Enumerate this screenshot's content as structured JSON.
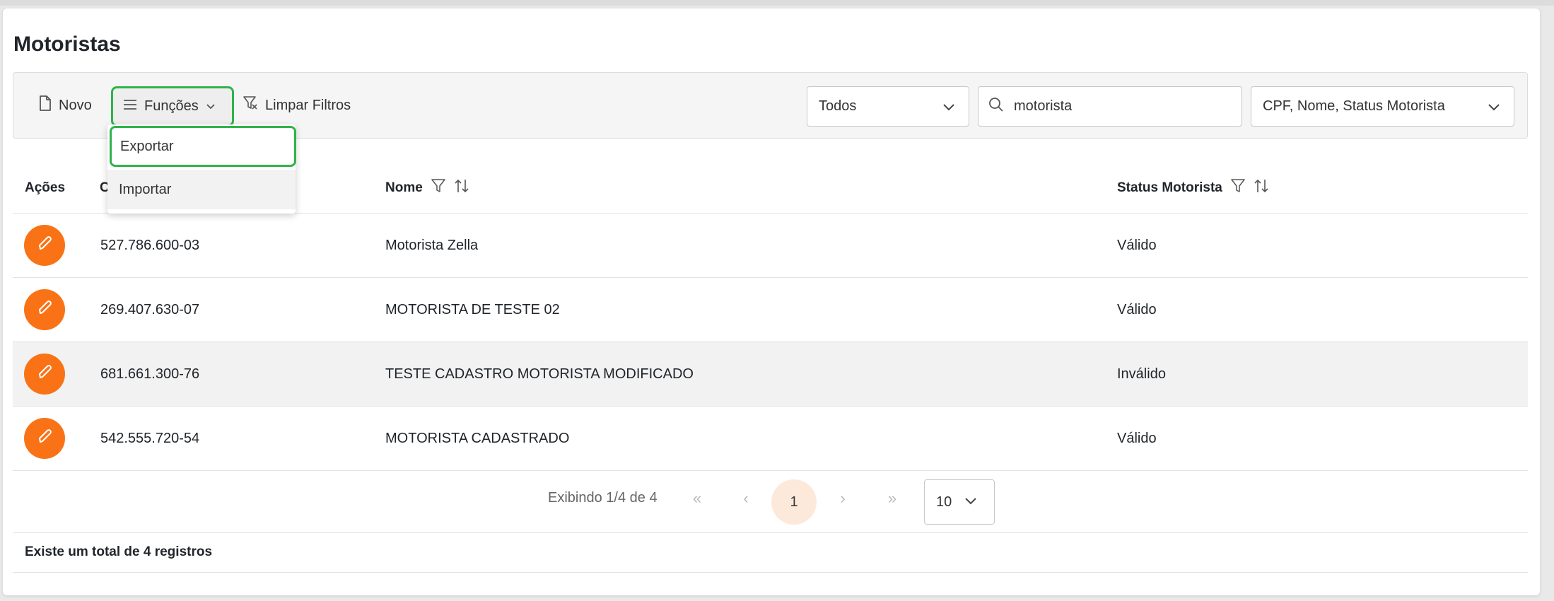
{
  "page": {
    "title": "Motoristas"
  },
  "toolbar": {
    "new_label": "Novo",
    "functions_label": "Funções",
    "clear_filters_label": "Limpar Filtros",
    "status_select_value": "Todos",
    "search_value": "motorista",
    "columns_select_value": "CPF, Nome, Status Motorista"
  },
  "dropdown": {
    "items": [
      "Exportar",
      "Importar"
    ]
  },
  "table": {
    "headers": {
      "actions": "Ações",
      "cpf": "C",
      "name": "Nome",
      "status": "Status Motorista"
    },
    "rows": [
      {
        "cpf": "527.786.600-03",
        "name": "Motorista Zella",
        "status": "Válido"
      },
      {
        "cpf": "269.407.630-07",
        "name": "MOTORISTA DE TESTE 02",
        "status": "Válido"
      },
      {
        "cpf": "681.661.300-76",
        "name": "TESTE CADASTRO MOTORISTA MODIFICADO",
        "status": "Inválido"
      },
      {
        "cpf": "542.555.720-54",
        "name": "MOTORISTA CADASTRADO",
        "status": "Válido"
      }
    ]
  },
  "pagination": {
    "info": "Exibindo 1/4 de 4",
    "current_page": "1",
    "per_page": "10",
    "first": "«",
    "prev": "‹",
    "next": "›",
    "last": "»"
  },
  "footer": {
    "total_text": "Existe um total de 4 registros"
  },
  "colors": {
    "accent": "#f97316",
    "highlight": "#2fb34a",
    "current_page_bg": "#fde9da"
  },
  "icons": {
    "new": "file-icon",
    "functions": "menu-icon",
    "clear_filters": "filter-clear-icon",
    "search": "search-icon",
    "dropdown": "chevron-down-icon",
    "edit": "pencil-icon",
    "filter": "filter-icon",
    "sort": "sort-icon"
  }
}
